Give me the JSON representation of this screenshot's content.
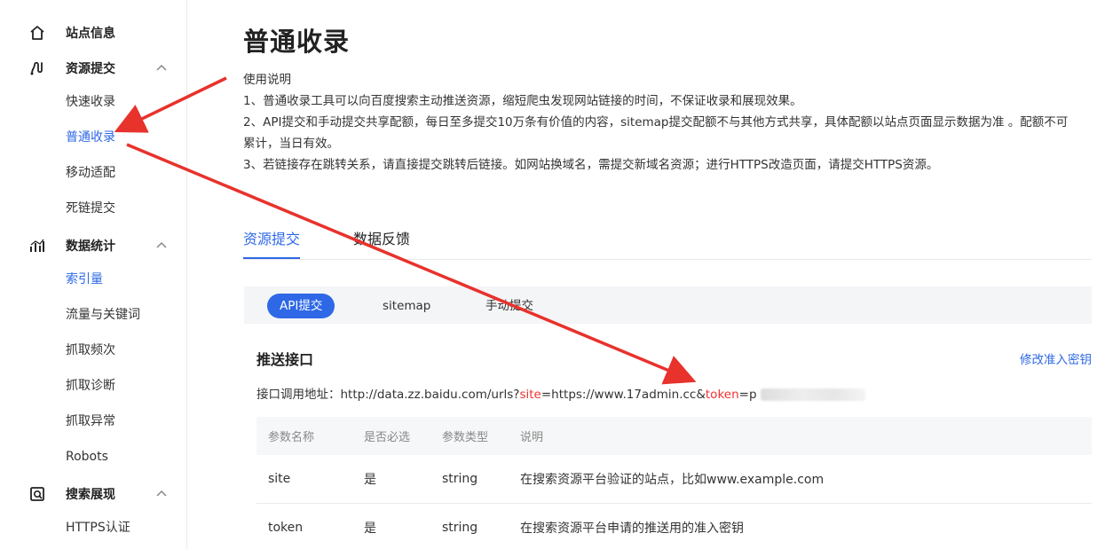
{
  "sidebar": {
    "groups": [
      {
        "label": "站点信息",
        "icon": "home-icon"
      },
      {
        "label": "资源提交",
        "icon": "resource-submit-icon"
      },
      {
        "label": "数据统计",
        "icon": "stats-icon"
      },
      {
        "label": "搜索展现",
        "icon": "search-display-icon"
      }
    ],
    "items": [
      "快速收录",
      "普通收录",
      "移动适配",
      "死链提交",
      "索引量",
      "流量与关键词",
      "抓取频次",
      "抓取诊断",
      "抓取异常",
      "Robots",
      "HTTPS认证"
    ]
  },
  "main": {
    "title": "普通收录",
    "instructions": [
      "使用说明",
      "1、普通收录工具可以向百度搜索主动推送资源，缩短爬虫发现网站链接的时间，不保证收录和展现效果。",
      "2、API提交和手动提交共享配额，每日至多提交10万条有价值的内容，sitemap提交配额不与其他方式共享，具体配额以站点页面显示数据为准 。配额不可",
      "累计，当日有效。",
      "3、若链接存在跳转关系，请直接提交跳转后链接。如网站换域名，需提交新域名资源；进行HTTPS改造页面，请提交HTTPS资源。"
    ],
    "tabs": [
      "资源提交",
      "数据反馈"
    ],
    "subtabs": [
      "API提交",
      "sitemap",
      "手动提交"
    ],
    "section_title": "推送接口",
    "modify_link": "修改准入密钥",
    "api_url": {
      "label": "接口调用地址：",
      "base": "http://data.zz.baidu.com/urls?",
      "site_key": "site",
      "site_value": "=https://www.17admin.cc&",
      "token_key": "token",
      "token_value": "=p"
    },
    "table": {
      "headers": [
        "参数名称",
        "是否必选",
        "参数类型",
        "说明"
      ],
      "rows": [
        [
          "site",
          "是",
          "string",
          "在搜索资源平台验证的站点，比如www.example.com"
        ],
        [
          "token",
          "是",
          "string",
          "在搜索资源平台申请的推送用的准入密钥"
        ]
      ]
    }
  },
  "colors": {
    "accent": "#2e68e6",
    "highlight": "#e33333",
    "arrow": "#e8322c"
  }
}
